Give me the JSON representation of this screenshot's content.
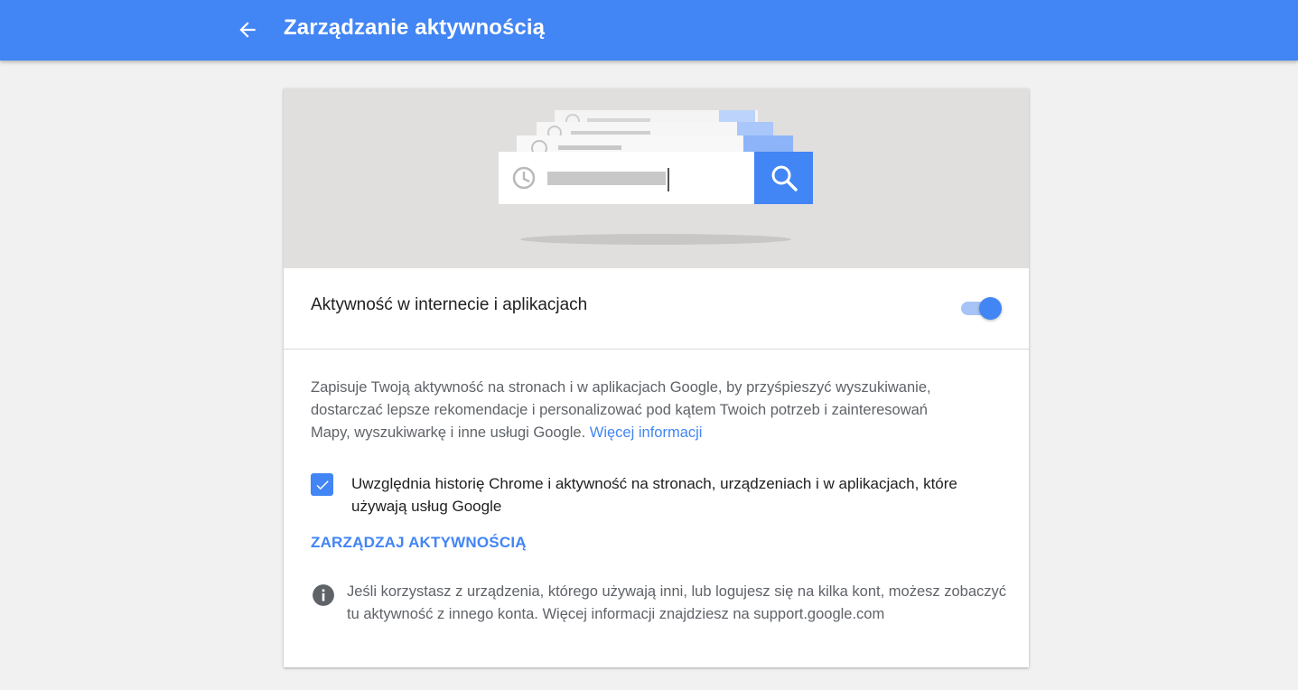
{
  "header": {
    "title": "Zarządzanie aktywnością",
    "back_icon": "arrow-left-icon",
    "color": "#4285f4"
  },
  "hero": {
    "illustration": "search-history-illustration",
    "icons": [
      "clock-icon",
      "search-icon"
    ]
  },
  "setting": {
    "label": "Aktywność w internecie i aplikacjach",
    "enabled": true,
    "description": "Zapisuje Twoją aktywność na stronach i w aplikacjach Google, by przyśpieszyć wyszukiwanie, dostarczać lepsze rekomendacje i personalizować pod kątem Twoich potrzeb i zainteresowań Mapy, wyszukiwarkę i inne usługi Google.",
    "more_info_link": "Więcej informacji"
  },
  "checkbox": {
    "checked": true,
    "label": "Uwzględnia historię Chrome i aktywność na stronach, urządzeniach i w aplikacjach, które używają usług Google"
  },
  "manage_activity": {
    "label": "ZARZĄDZAJ AKTYWNOŚCIĄ"
  },
  "info": {
    "icon": "info-icon",
    "text": "Jeśli korzystasz z urządzenia, którego używają inni, lub logujesz się na kilka kont, możesz zobaczyć tu aktywność z innego konta. Więcej informacji znajdziesz na support.google.com"
  },
  "colors": {
    "accent": "#4285f4",
    "background": "#f1f1f1",
    "hero_bg": "#e0dfde"
  }
}
